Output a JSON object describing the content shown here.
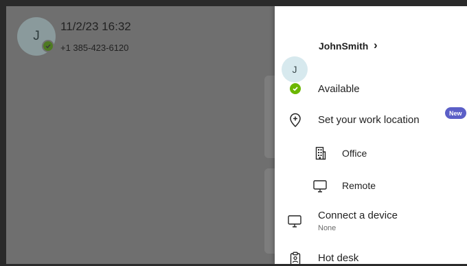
{
  "background": {
    "avatar_initial": "J",
    "datetime": "11/2/23 16:32",
    "phone": "+1 385-423-6120"
  },
  "panel": {
    "profile": {
      "avatar_initial": "J",
      "name": "JohnSmith",
      "chevron": "›"
    },
    "status": {
      "label": "Available",
      "icon": "check-circle-icon",
      "color": "#6bb700"
    },
    "work_location": {
      "label": "Set your work location",
      "badge": "New",
      "icon": "location-pin-plus-icon",
      "options": [
        {
          "label": "Office",
          "icon": "building-icon"
        },
        {
          "label": "Remote",
          "icon": "monitor-icon"
        }
      ]
    },
    "connect_device": {
      "label": "Connect a device",
      "value": "None",
      "icon": "monitor-icon"
    },
    "hot_desk": {
      "label": "Hot desk",
      "icon": "clipboard-person-icon"
    }
  },
  "colors": {
    "accent": "#5b5fc7",
    "available": "#6bb700",
    "overlay": "#6f6f6f"
  }
}
